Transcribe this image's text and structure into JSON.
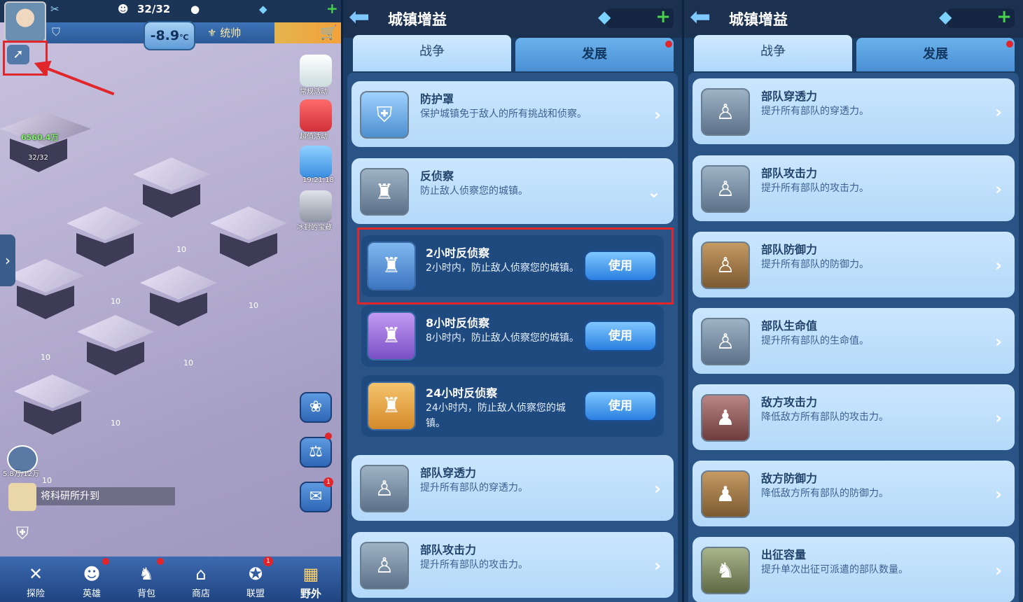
{
  "left": {
    "energy": "32/32",
    "temperature": "-8.9",
    "temperature_unit": "℃",
    "title_badge": "统帅",
    "map_labels": {
      "power": "6560.4万",
      "stamina": "32/32"
    },
    "house_levels": [
      "10",
      "10",
      "10",
      "10",
      "10",
      "10",
      "10"
    ],
    "side_events": [
      {
        "label": "常规活动"
      },
      {
        "label": "超值活动"
      },
      {
        "label": "19:21:18"
      },
      {
        "label": "冰封的宝藏"
      }
    ],
    "resource": "5.8万/12万",
    "news": "将科研所升到",
    "mail_badge": "1",
    "alliance_badge": "1",
    "nav": [
      {
        "label": "探险",
        "icon": "✕"
      },
      {
        "label": "英雄",
        "icon": "☻"
      },
      {
        "label": "背包",
        "icon": "♞"
      },
      {
        "label": "商店",
        "icon": "⌂"
      },
      {
        "label": "联盟",
        "icon": "✪"
      },
      {
        "label": "野外",
        "icon": "▦"
      }
    ]
  },
  "panel2": {
    "title": "城镇增益",
    "tabs": [
      {
        "label": "战争"
      },
      {
        "label": "发展"
      }
    ],
    "cards": [
      {
        "title": "防护罩",
        "desc": "保护城镇免于敌人的所有挑战和侦察。",
        "chev": "›"
      },
      {
        "title": "反侦察",
        "desc": "防止敌人侦察您的城镇。",
        "chev": "⌄"
      }
    ],
    "subitems": [
      {
        "title": "2小时反侦察",
        "desc": "2小时内，防止敌人侦察您的城镇。",
        "button": "使用"
      },
      {
        "title": "8小时反侦察",
        "desc": "8小时内，防止敌人侦察您的城镇。",
        "button": "使用"
      },
      {
        "title": "24小时反侦察",
        "desc": "24小时内，防止敌人侦察您的城镇。",
        "button": "使用"
      }
    ],
    "cards_bottom": [
      {
        "title": "部队穿透力",
        "desc": "提升所有部队的穿透力。",
        "chev": "›"
      },
      {
        "title": "部队攻击力",
        "desc": "提升所有部队的攻击力。",
        "chev": "›"
      }
    ]
  },
  "panel3": {
    "title": "城镇增益",
    "tabs": [
      {
        "label": "战争"
      },
      {
        "label": "发展"
      }
    ],
    "cards": [
      {
        "title": "部队穿透力",
        "desc": "提升所有部队的穿透力。",
        "chev": "›"
      },
      {
        "title": "部队攻击力",
        "desc": "提升所有部队的攻击力。",
        "chev": "›"
      },
      {
        "title": "部队防御力",
        "desc": "提升所有部队的防御力。",
        "chev": "›"
      },
      {
        "title": "部队生命值",
        "desc": "提升所有部队的生命值。",
        "chev": "›"
      },
      {
        "title": "敌方攻击力",
        "desc": "降低敌方所有部队的攻击力。",
        "chev": "›"
      },
      {
        "title": "敌方防御力",
        "desc": "降低敌方所有部队的防御力。",
        "chev": "›"
      },
      {
        "title": "出征容量",
        "desc": "提升单次出征可派遣的部队数量。",
        "chev": "›"
      }
    ]
  }
}
